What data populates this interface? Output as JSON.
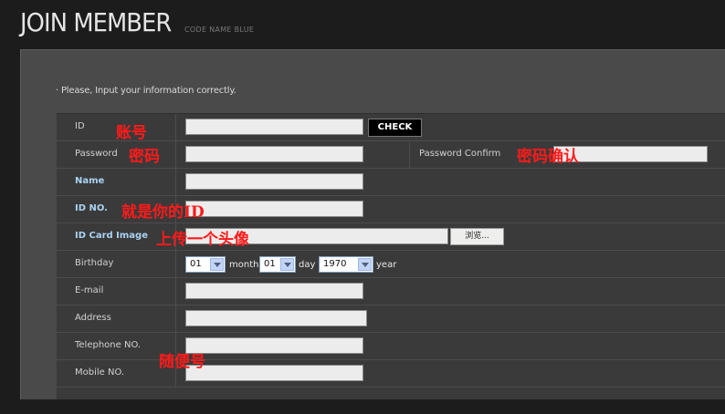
{
  "header": {
    "title": "JOIN MEMBER",
    "subtitle": "CODE NAME BLUE"
  },
  "notice": "· Please, Input your information correctly.",
  "form": {
    "rows": [
      {
        "label": "ID",
        "bold": false
      },
      {
        "label": "Password",
        "bold": false
      },
      {
        "label": "Name",
        "bold": true
      },
      {
        "label": "ID NO.",
        "bold": true
      },
      {
        "label": "ID Card Image",
        "bold": true
      },
      {
        "label": "Birthday",
        "bold": false
      },
      {
        "label": "E-mail",
        "bold": false
      },
      {
        "label": "Address",
        "bold": false
      },
      {
        "label": "Telephone NO.",
        "bold": false
      },
      {
        "label": "Mobile NO.",
        "bold": false
      }
    ],
    "check_label": "CHECK",
    "password_confirm_label": "Password Confirm",
    "browse_label": "浏览...",
    "birthday": {
      "month_value": "01",
      "month_unit": "month",
      "day_value": "01",
      "day_unit": "day",
      "year_value": "1970",
      "year_unit": "year"
    },
    "inputs": {
      "id": "",
      "password": "",
      "password_confirm": "",
      "name": "",
      "id_no": "",
      "id_card_image": "",
      "email": "",
      "address": "",
      "telephone": "",
      "mobile": ""
    }
  },
  "annotations": {
    "id_note": "账号",
    "password_note": "密码",
    "confirm_note": "密码确认",
    "id_no_note": "就是你的ID",
    "image_note": "上传一个头像",
    "phone_note": "随便号"
  },
  "colors": {
    "page_bg": "#1c1c1c",
    "panel_bg": "#4a4a4a",
    "form_bg": "#3a3a3a",
    "bold_label": "#a9d3f3",
    "annotation": "#ff1a1a"
  }
}
